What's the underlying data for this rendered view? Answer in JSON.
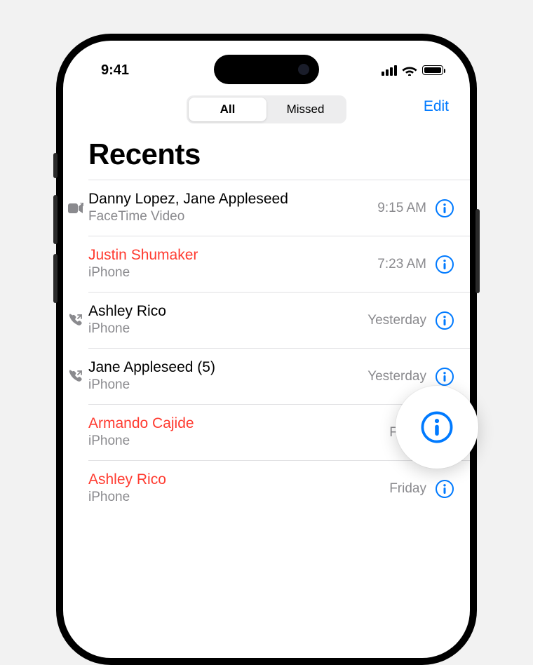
{
  "status": {
    "time": "9:41"
  },
  "nav": {
    "segment_all": "All",
    "segment_missed": "Missed",
    "edit": "Edit",
    "active": "all"
  },
  "title": "Recents",
  "calls": [
    {
      "name": "Danny Lopez, Jane Appleseed",
      "sub": "FaceTime Video",
      "time": "9:15 AM",
      "missed": false,
      "icon": "facetime"
    },
    {
      "name": "Justin Shumaker",
      "sub": "iPhone",
      "time": "7:23 AM",
      "missed": true,
      "icon": "none"
    },
    {
      "name": "Ashley Rico",
      "sub": "iPhone",
      "time": "Yesterday",
      "missed": false,
      "icon": "outgoing"
    },
    {
      "name": "Jane Appleseed (5)",
      "sub": "iPhone",
      "time": "Yesterday",
      "missed": false,
      "icon": "outgoing"
    },
    {
      "name": "Armando Cajide",
      "sub": "iPhone",
      "time": "Friday",
      "missed": true,
      "icon": "none"
    },
    {
      "name": "Ashley Rico",
      "sub": "iPhone",
      "time": "Friday",
      "missed": true,
      "icon": "none"
    }
  ]
}
